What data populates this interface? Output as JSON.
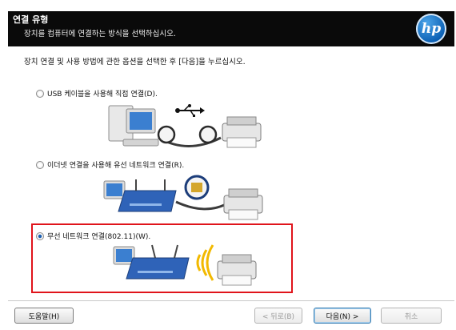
{
  "header": {
    "title": "연결 유형",
    "subtitle": "장치를 컴퓨터에 연결하는 방식을 선택하십시오.",
    "logo_text": "hp"
  },
  "instruction": "장치 연결 및 사용 방법에 관한 옵션을 선택한 후 [다음]을 누르십시오.",
  "options": [
    {
      "label": "USB 케이블을 사용해 직접 연결(D).",
      "selected": false,
      "illustration": "usb-connection-illustration"
    },
    {
      "label": "이더넷 연결을 사용해 유선 네트워크 연결(R).",
      "selected": false,
      "illustration": "ethernet-connection-illustration"
    },
    {
      "label": "무선 네트워크 연결(802.11)(W).",
      "selected": true,
      "illustration": "wireless-connection-illustration"
    }
  ],
  "buttons": {
    "help": "도움말(H)",
    "back": "< 뒤로(B)",
    "next": "다음(N) >",
    "cancel": "취소"
  },
  "colors": {
    "header_bg": "#0a0a0a",
    "selection_outline": "#e0141b",
    "hp_blue": "#0b5fb3"
  }
}
